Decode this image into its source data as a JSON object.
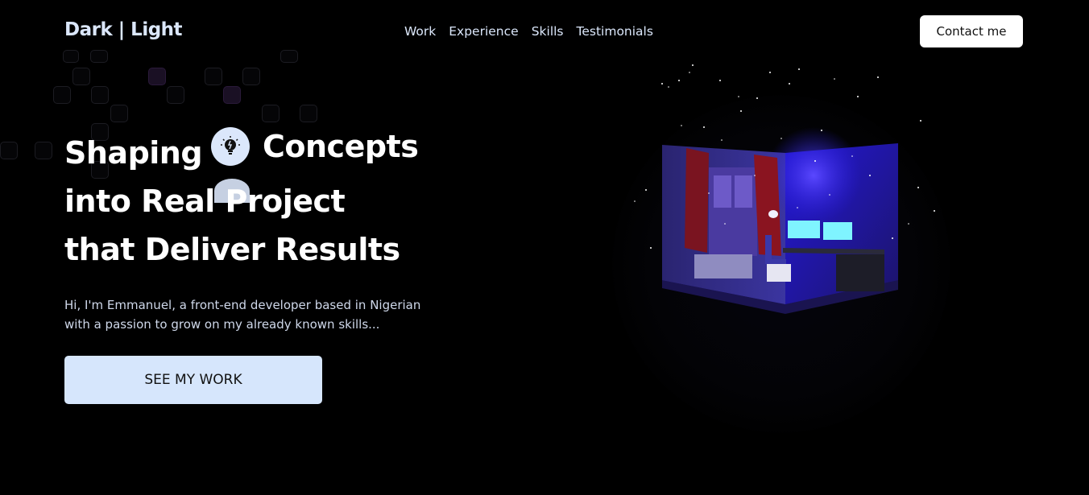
{
  "header": {
    "logo": "Dark | Light",
    "nav": [
      "Work",
      "Experience",
      "Skills",
      "Testimonials"
    ],
    "contact_label": "Contact me"
  },
  "hero": {
    "line1_word1": "Shaping",
    "line1_word2": "Concepts",
    "line2": "into Real Project",
    "line3": "that Deliver Results",
    "intro": "Hi, I'm Emmanuel, a front-end developer based in Nigerian with a passion to grow on my already known skills...",
    "cta_label": "SEE MY WORK"
  },
  "icons": {
    "concept_icon": "lightbulb-icon"
  },
  "colors": {
    "background": "#000000",
    "accent": "#d6e6fc",
    "logo_text": "#dbe7fb"
  }
}
